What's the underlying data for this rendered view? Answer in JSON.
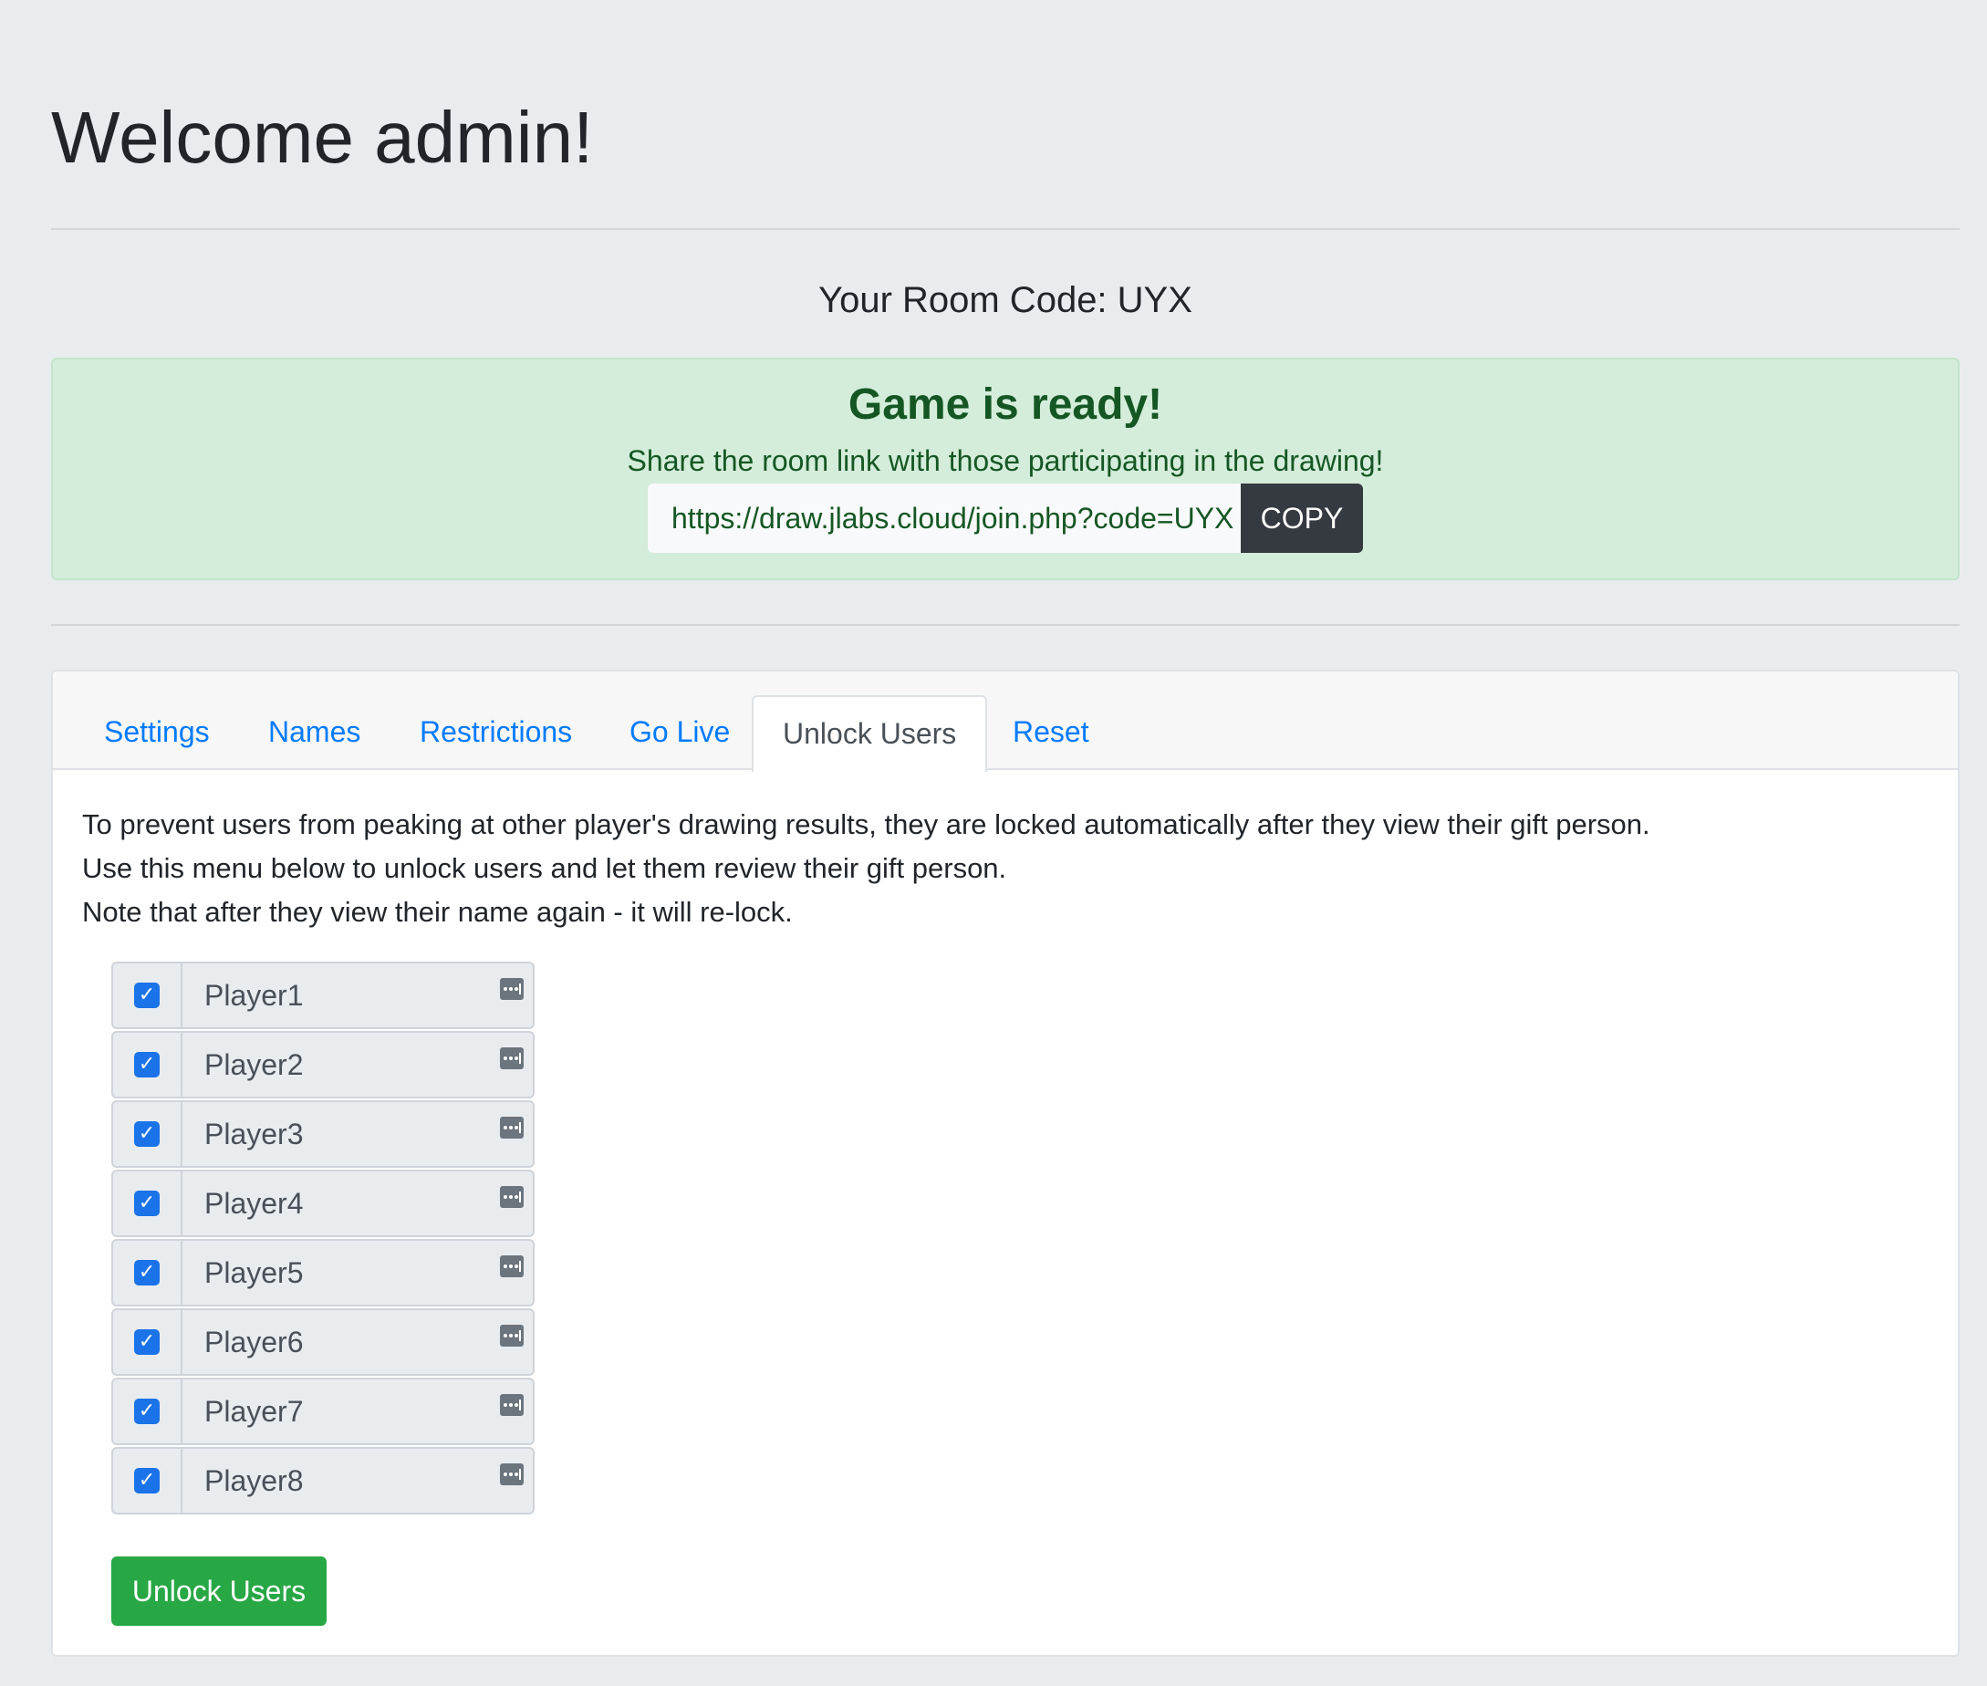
{
  "header": {
    "title": "Welcome admin!",
    "room_code_label": "Your Room Code:",
    "room_code": "UYX"
  },
  "alert": {
    "title": "Game is ready!",
    "text": "Share the room link with those participating in the drawing!",
    "link": "https://draw.jlabs.cloud/join.php?code=UYX",
    "copy_label": "COPY",
    "color": "#155724",
    "background": "#d4edda"
  },
  "tabs": [
    {
      "label": "Settings",
      "active": false
    },
    {
      "label": "Names",
      "active": false
    },
    {
      "label": "Restrictions",
      "active": false
    },
    {
      "label": "Go Live",
      "active": false
    },
    {
      "label": "Unlock Users",
      "active": true
    },
    {
      "label": "Reset",
      "active": false
    }
  ],
  "unlock": {
    "line1": "To prevent users from peaking at other player's drawing results, they are locked automatically after they view their gift person.",
    "line2": "Use this menu below to unlock users and let them review their gift person.",
    "note": "Note that after they view their name again - it will re-lock.",
    "users": [
      {
        "name": "Player1",
        "checked": true
      },
      {
        "name": "Player2",
        "checked": true
      },
      {
        "name": "Player3",
        "checked": true
      },
      {
        "name": "Player4",
        "checked": true
      },
      {
        "name": "Player5",
        "checked": true
      },
      {
        "name": "Player6",
        "checked": true
      },
      {
        "name": "Player7",
        "checked": true
      },
      {
        "name": "Player8",
        "checked": true
      }
    ],
    "button_label": "Unlock Users",
    "button_color": "#28a745"
  },
  "icons": {
    "checkbox": "check-icon",
    "user_field": "ellipsis-icon"
  }
}
